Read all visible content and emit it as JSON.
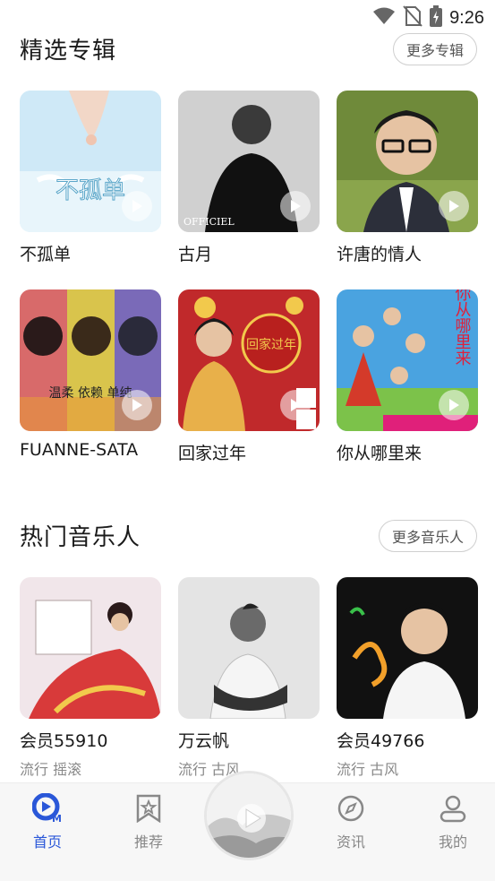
{
  "status_bar": {
    "time": "9:26",
    "icons": [
      "wifi-icon",
      "no-sim-icon",
      "battery-charging-icon"
    ]
  },
  "albums_section": {
    "title": "精选专辑",
    "more_label": "更多专辑",
    "items": [
      {
        "title": "不孤单",
        "cover_text": "不孤单"
      },
      {
        "title": "古月",
        "cover_text": "OFFICIEL"
      },
      {
        "title": "许唐的情人"
      },
      {
        "title": "FUANNE-SATA",
        "cover_text": "温柔 依赖 单纯"
      },
      {
        "title": "回家过年",
        "cover_text": "回家过年"
      },
      {
        "title": "你从哪里来",
        "cover_text": "你从哪里来"
      }
    ]
  },
  "artists_section": {
    "title": "热门音乐人",
    "more_label": "更多音乐人",
    "items": [
      {
        "name": "会员55910",
        "genres": "流行 摇滚"
      },
      {
        "name": "万云帆",
        "genres": "流行 古风"
      },
      {
        "name": "会员49766",
        "genres": "流行 古风"
      }
    ]
  },
  "bottom_nav": {
    "items": [
      {
        "label": "首页",
        "icon": "home-music-icon",
        "active": true
      },
      {
        "label": "推荐",
        "icon": "star-bookmark-icon",
        "active": false
      },
      {
        "label": "",
        "icon": "now-playing-disc",
        "active": false
      },
      {
        "label": "资讯",
        "icon": "compass-icon",
        "active": false
      },
      {
        "label": "我的",
        "icon": "user-icon",
        "active": false
      }
    ]
  },
  "colors": {
    "accent": "#2a57d8",
    "text": "#1a1a1a",
    "muted": "#888888",
    "nav_bg": "#f7f7f7"
  }
}
